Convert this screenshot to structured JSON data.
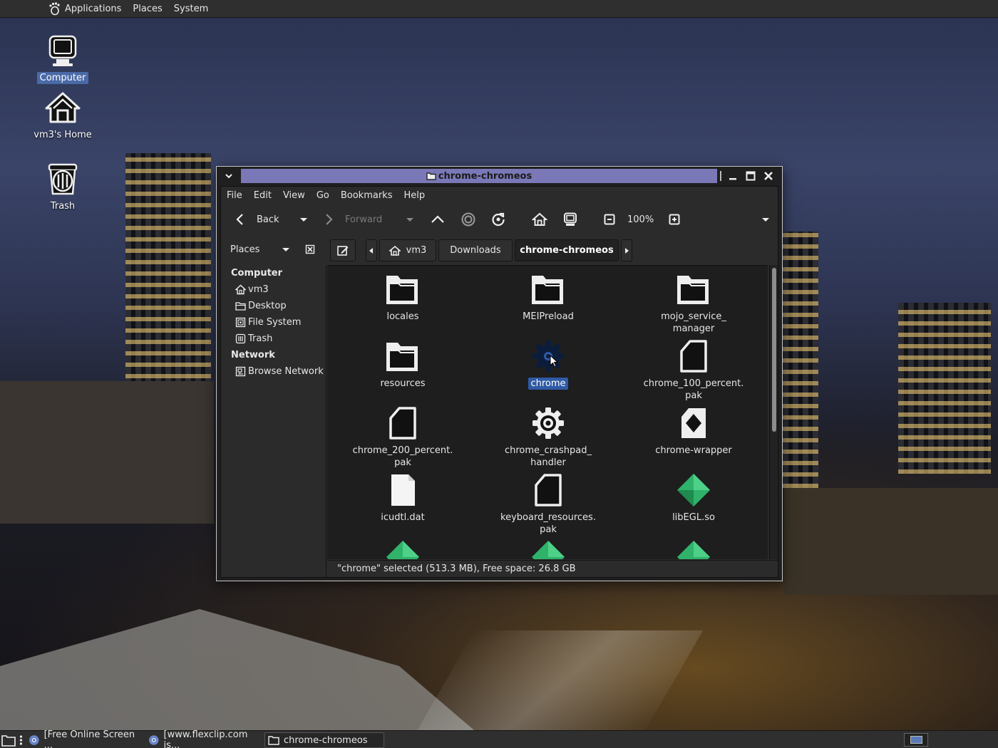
{
  "top_panel": {
    "items": [
      {
        "label": "Applications"
      },
      {
        "label": "Places"
      },
      {
        "label": "System"
      }
    ]
  },
  "desktop_icons": [
    {
      "label": "Computer",
      "icon": "computer-icon"
    },
    {
      "label": "vm3's Home",
      "icon": "home-icon"
    },
    {
      "label": "Trash",
      "icon": "trash-icon"
    }
  ],
  "window": {
    "title": "chrome-chromeos",
    "menu": [
      "File",
      "Edit",
      "View",
      "Go",
      "Bookmarks",
      "Help"
    ],
    "toolbar": {
      "back_label": "Back",
      "forward_label": "Forward",
      "zoom": "100%"
    },
    "places_label": "Places",
    "path": [
      "vm3",
      "Downloads",
      "chrome-chromeos"
    ],
    "sidebar": {
      "computer_head": "Computer",
      "computer_items": [
        {
          "label": "vm3",
          "icon": "home-icon"
        },
        {
          "label": "Desktop",
          "icon": "folder-icon"
        },
        {
          "label": "File System",
          "icon": "drive-icon"
        },
        {
          "label": "Trash",
          "icon": "trash-icon"
        }
      ],
      "network_head": "Network",
      "network_items": [
        {
          "label": "Browse Network",
          "icon": "network-icon"
        }
      ]
    },
    "files": [
      {
        "line1": "locales",
        "line2": "",
        "icon": "folder-icon"
      },
      {
        "line1": "MEIPreload",
        "line2": "",
        "icon": "folder-icon"
      },
      {
        "line1": "mojo_service_",
        "line2": "manager",
        "icon": "folder-icon"
      },
      {
        "line1": "resources",
        "line2": "",
        "icon": "folder-icon"
      },
      {
        "line1": "chrome",
        "line2": "",
        "icon": "executable-gear-icon",
        "selected": true
      },
      {
        "line1": "chrome_100_percent.",
        "line2": "pak",
        "icon": "file-icon"
      },
      {
        "line1": "chrome_200_percent.",
        "line2": "pak",
        "icon": "file-icon"
      },
      {
        "line1": "chrome_crashpad_",
        "line2": "handler",
        "icon": "executable-gear-icon"
      },
      {
        "line1": "chrome-wrapper",
        "line2": "",
        "icon": "script-icon"
      },
      {
        "line1": "icudtl.dat",
        "line2": "",
        "icon": "blank-file-icon"
      },
      {
        "line1": "keyboard_resources.",
        "line2": "pak",
        "icon": "file-icon"
      },
      {
        "line1": "libEGL.so",
        "line2": "",
        "icon": "library-icon"
      },
      {
        "line1": "",
        "line2": "",
        "icon": "library-icon"
      },
      {
        "line1": "",
        "line2": "",
        "icon": "library-icon"
      },
      {
        "line1": "",
        "line2": "",
        "icon": "library-icon"
      }
    ],
    "status": "\"chrome\" selected (513.3 MB), Free space: 26.8 GB"
  },
  "taskbar": [
    {
      "label": "[Free Online Screen ...",
      "icon": "browser-icon"
    },
    {
      "label": "[www.flexclip.com is...",
      "icon": "browser-icon"
    },
    {
      "label": "chrome-chromeos",
      "icon": "folder-icon",
      "active": true
    }
  ],
  "colors": {
    "titlebar_accent": "#7b78b8",
    "selection": "#2f5aa5",
    "library_green": "#2fb36a"
  }
}
